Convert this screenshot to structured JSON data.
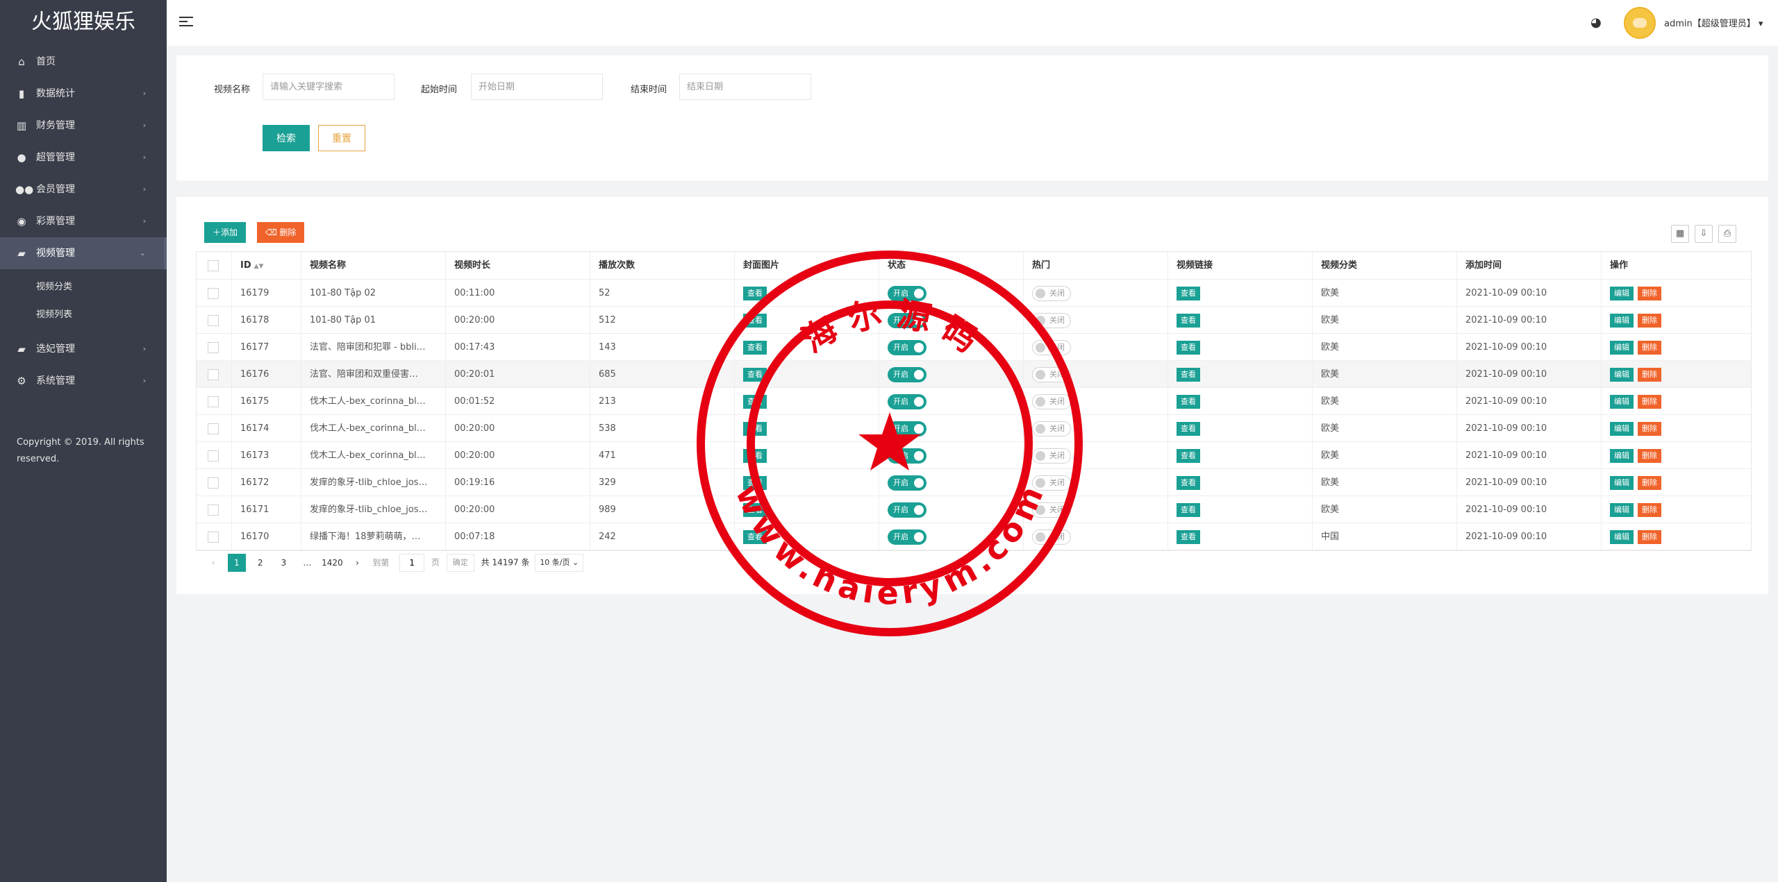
{
  "app": {
    "title": "火狐狸娱乐"
  },
  "sidebar": {
    "items": [
      {
        "label": "首页",
        "icon": "home-icon"
      },
      {
        "label": "数据统计",
        "icon": "bar-chart-icon"
      },
      {
        "label": "财务管理",
        "icon": "bank-icon"
      },
      {
        "label": "超管管理",
        "icon": "user-icon"
      },
      {
        "label": "会员管理",
        "icon": "users-icon"
      },
      {
        "label": "彩票管理",
        "icon": "gamepad-icon"
      },
      {
        "label": "视频管理",
        "icon": "video-icon",
        "expanded": true
      },
      {
        "label": "选妃管理",
        "icon": "video-icon"
      },
      {
        "label": "系统管理",
        "icon": "gear-icon"
      }
    ],
    "sub_items": [
      "视频分类",
      "视频列表"
    ],
    "copyright": "Copyright © 2019. All rights reserved."
  },
  "header": {
    "user": "admin【超级管理员】",
    "icons": [
      "menu-icon",
      "palette-icon",
      "avatar",
      "caret-down-icon"
    ]
  },
  "search": {
    "name_label": "视频名称",
    "name_placeholder": "请输入关键字搜索",
    "start_label": "起始时间",
    "start_placeholder": "开始日期",
    "end_label": "结束时间",
    "end_placeholder": "结束日期",
    "search_button": "检索",
    "reset_button": "重置"
  },
  "toolbar": {
    "add_label": "添加",
    "delete_label": "删除",
    "right_icons": [
      "columns-icon",
      "export-icon",
      "print-icon"
    ]
  },
  "table": {
    "columns": [
      "ID",
      "视频名称",
      "视频时长",
      "播放次数",
      "封面图片",
      "状态",
      "热门",
      "视频链接",
      "视频分类",
      "添加时间",
      "操作"
    ],
    "view_label": "查看",
    "status_on_label": "开启",
    "hot_off_label": "关闭",
    "edit_label": "编辑",
    "delete_label": "删除",
    "rows": [
      {
        "id": "16179",
        "name": "101-80 Tập 02",
        "duration": "00:11:00",
        "plays": "52",
        "category": "欧美",
        "added": "2021-10-09 00:10"
      },
      {
        "id": "16178",
        "name": "101-80 Tập 01",
        "duration": "00:20:00",
        "plays": "512",
        "category": "欧美",
        "added": "2021-10-09 00:10"
      },
      {
        "id": "16177",
        "name": "法官、陪审团和犯罪 - bbli…",
        "duration": "00:17:43",
        "plays": "143",
        "category": "欧美",
        "added": "2021-10-09 00:10"
      },
      {
        "id": "16176",
        "name": "法官、陪审团和双重侵害…",
        "duration": "00:20:01",
        "plays": "685",
        "category": "欧美",
        "added": "2021-10-09 00:10"
      },
      {
        "id": "16175",
        "name": "伐木工人-bex_corinna_bl…",
        "duration": "00:01:52",
        "plays": "213",
        "category": "欧美",
        "added": "2021-10-09 00:10"
      },
      {
        "id": "16174",
        "name": "伐木工人-bex_corinna_bl…",
        "duration": "00:20:00",
        "plays": "538",
        "category": "欧美",
        "added": "2021-10-09 00:10"
      },
      {
        "id": "16173",
        "name": "伐木工人-bex_corinna_bl…",
        "duration": "00:20:00",
        "plays": "471",
        "category": "欧美",
        "added": "2021-10-09 00:10"
      },
      {
        "id": "16172",
        "name": "发痒的象牙-tlib_chloe_jos…",
        "duration": "00:19:16",
        "plays": "329",
        "category": "欧美",
        "added": "2021-10-09 00:10"
      },
      {
        "id": "16171",
        "name": "发痒的象牙-tlib_chloe_jos…",
        "duration": "00:20:00",
        "plays": "989",
        "category": "欧美",
        "added": "2021-10-09 00:10"
      },
      {
        "id": "16170",
        "name": "绿播下海！18萝莉萌萌，…",
        "duration": "00:07:18",
        "plays": "242",
        "category": "中国",
        "added": "2021-10-09 00:10"
      }
    ]
  },
  "pagination": {
    "pages": [
      "1",
      "2",
      "3",
      "…",
      "1420"
    ],
    "current": "1",
    "goto_label": "到第",
    "goto_value": "1",
    "page_unit": "页",
    "confirm": "确定",
    "total": "共 14197 条",
    "per_page": "10 条/页"
  },
  "seal": {
    "top_text": "海 尔 源 码",
    "bottom_text": "www.haierym.com",
    "color": "#e60012"
  },
  "colors": {
    "accent": "#1aa094",
    "danger": "#f0632a",
    "sidebar": "#393d49",
    "reset": "#e6a23c"
  }
}
